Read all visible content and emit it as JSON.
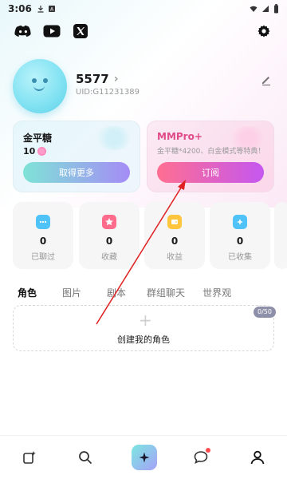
{
  "status_bar": {
    "time": "3:06"
  },
  "profile": {
    "username": "5577",
    "uid": "UID:G11231389"
  },
  "cards": {
    "left": {
      "title": "金平糖",
      "count": "10",
      "button": "取得更多"
    },
    "right": {
      "title": "MMPro+",
      "desc": "金平糖*4200、白金模式等特典！",
      "button": "订阅"
    }
  },
  "stats": [
    {
      "value": "0",
      "label": "已聊过",
      "icon": "chat-bubble-icon",
      "color": "#4fc3f7"
    },
    {
      "value": "0",
      "label": "收藏",
      "icon": "star-icon",
      "color": "#ff6b8a"
    },
    {
      "value": "0",
      "label": "收益",
      "icon": "wallet-icon",
      "color": "#ffc53d"
    },
    {
      "value": "0",
      "label": "已收集",
      "icon": "plus-card-icon",
      "color": "#4fc3f7"
    }
  ],
  "tabs": [
    "角色",
    "图片",
    "剧本",
    "群组聊天",
    "世界观"
  ],
  "create_role": {
    "plus": "+",
    "label": "创建我的角色",
    "count": "0/50"
  },
  "colors": {
    "accent_pink": "#e04a88",
    "arrow_red": "#e02020"
  }
}
